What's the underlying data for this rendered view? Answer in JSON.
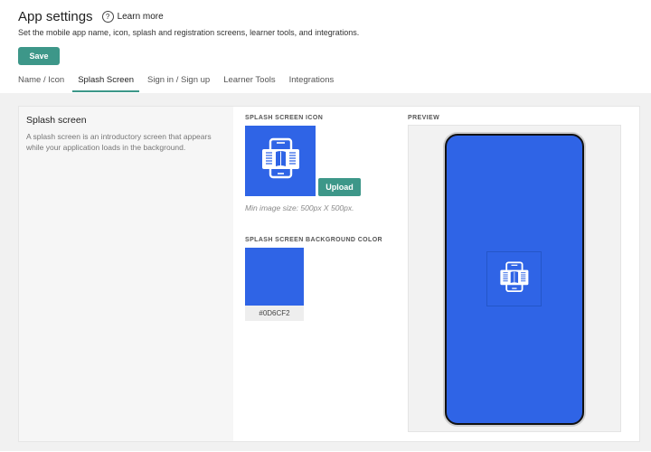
{
  "header": {
    "title": "App settings",
    "learn_more": "Learn more",
    "subtitle": "Set the mobile app name, icon, splash and registration screens, learner tools, and integrations.",
    "save_label": "Save"
  },
  "tabs": [
    {
      "label": "Name / Icon",
      "active": false
    },
    {
      "label": "Splash Screen",
      "active": true
    },
    {
      "label": "Sign in / Sign up",
      "active": false
    },
    {
      "label": "Learner Tools",
      "active": false
    },
    {
      "label": "Integrations",
      "active": false
    }
  ],
  "splash": {
    "title": "Splash screen",
    "description": "A splash screen is an introductory screen that appears while your application loads in the background.",
    "icon_label": "SPLASH SCREEN ICON",
    "upload_label": "Upload",
    "min_size": "Min image size: 500px X 500px.",
    "bg_color_label": "SPLASH SCREEN BACKGROUND COLOR",
    "bg_color_value": "#0D6CF2",
    "preview_label": "PREVIEW"
  },
  "colors": {
    "accent": "#3d9789",
    "splash_blue": "#2f64e6"
  },
  "icons": {
    "help": "help-icon",
    "app_icon": "mobile-book-icon"
  }
}
